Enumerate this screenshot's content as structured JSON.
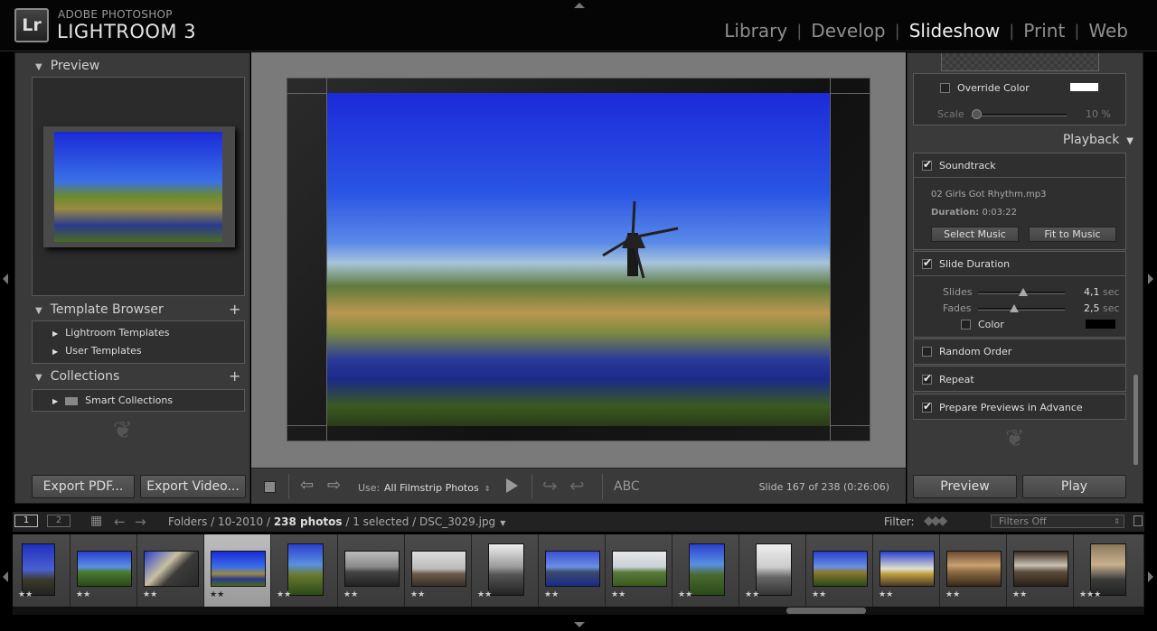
{
  "app": {
    "brand_line1": "ADOBE PHOTOSHOP",
    "brand_line2": "LIGHTROOM 3",
    "logo": "Lr"
  },
  "modules": [
    {
      "label": "Library",
      "active": false
    },
    {
      "label": "Develop",
      "active": false
    },
    {
      "label": "Slideshow",
      "active": true
    },
    {
      "label": "Print",
      "active": false
    },
    {
      "label": "Web",
      "active": false
    }
  ],
  "left": {
    "preview_title": "Preview",
    "template_title": "Template Browser",
    "templates": [
      "Lightroom Templates",
      "User Templates"
    ],
    "collections_title": "Collections",
    "collections": [
      "Smart Collections"
    ],
    "export_pdf": "Export PDF...",
    "export_video": "Export Video..."
  },
  "right": {
    "override_color": "Override Color",
    "scale_label": "Scale",
    "scale_value": "10 %",
    "scale_level_percent": 10,
    "playback_title": "Playback",
    "soundtrack": "Soundtrack",
    "track": "02 Girls Got Rhythm.mp3",
    "duration_label": "Duration:",
    "duration_value": "0:03:22",
    "select_music": "Select Music",
    "fit_to_music": "Fit to Music",
    "slide_duration": "Slide Duration",
    "slides_label": "Slides",
    "slides_value": "4,1",
    "fades_label": "Fades",
    "fades_value": "2,5",
    "sec": "sec",
    "color_label": "Color",
    "random_order": "Random Order",
    "repeat": "Repeat",
    "prepare_previews": "Prepare Previews in Advance",
    "preview_btn": "Preview",
    "play_btn": "Play"
  },
  "toolbar": {
    "use_label": "Use:",
    "use_value": "All Filmstrip Photos",
    "abc": "ABC",
    "slide_info": "Slide 167 of 238 (0:26:06)"
  },
  "filmbar": {
    "page1": "1",
    "page2": "2",
    "folders": "Folders",
    "path_sep1": " / ",
    "folder": "10-2010",
    "path_sep2": " / ",
    "photos": "238 photos",
    "path_sep3": " / ",
    "selected": "1 selected",
    "path_sep4": " / ",
    "file": "DSC_3029.jpg",
    "filter_label": "Filter:",
    "filter_value": "Filters Off"
  },
  "filmstrip": {
    "stars": [
      "★★",
      "★★",
      "★★",
      "★★",
      "★★",
      "★★",
      "★★",
      "★★",
      "★★",
      "★★",
      "★★",
      "★★",
      "★★",
      "★★",
      "★★",
      "★★",
      "★★★"
    ]
  },
  "colors": {
    "accent_blue": "#2a3fd0",
    "panel": "#3a3a3a",
    "background": "#000000"
  }
}
